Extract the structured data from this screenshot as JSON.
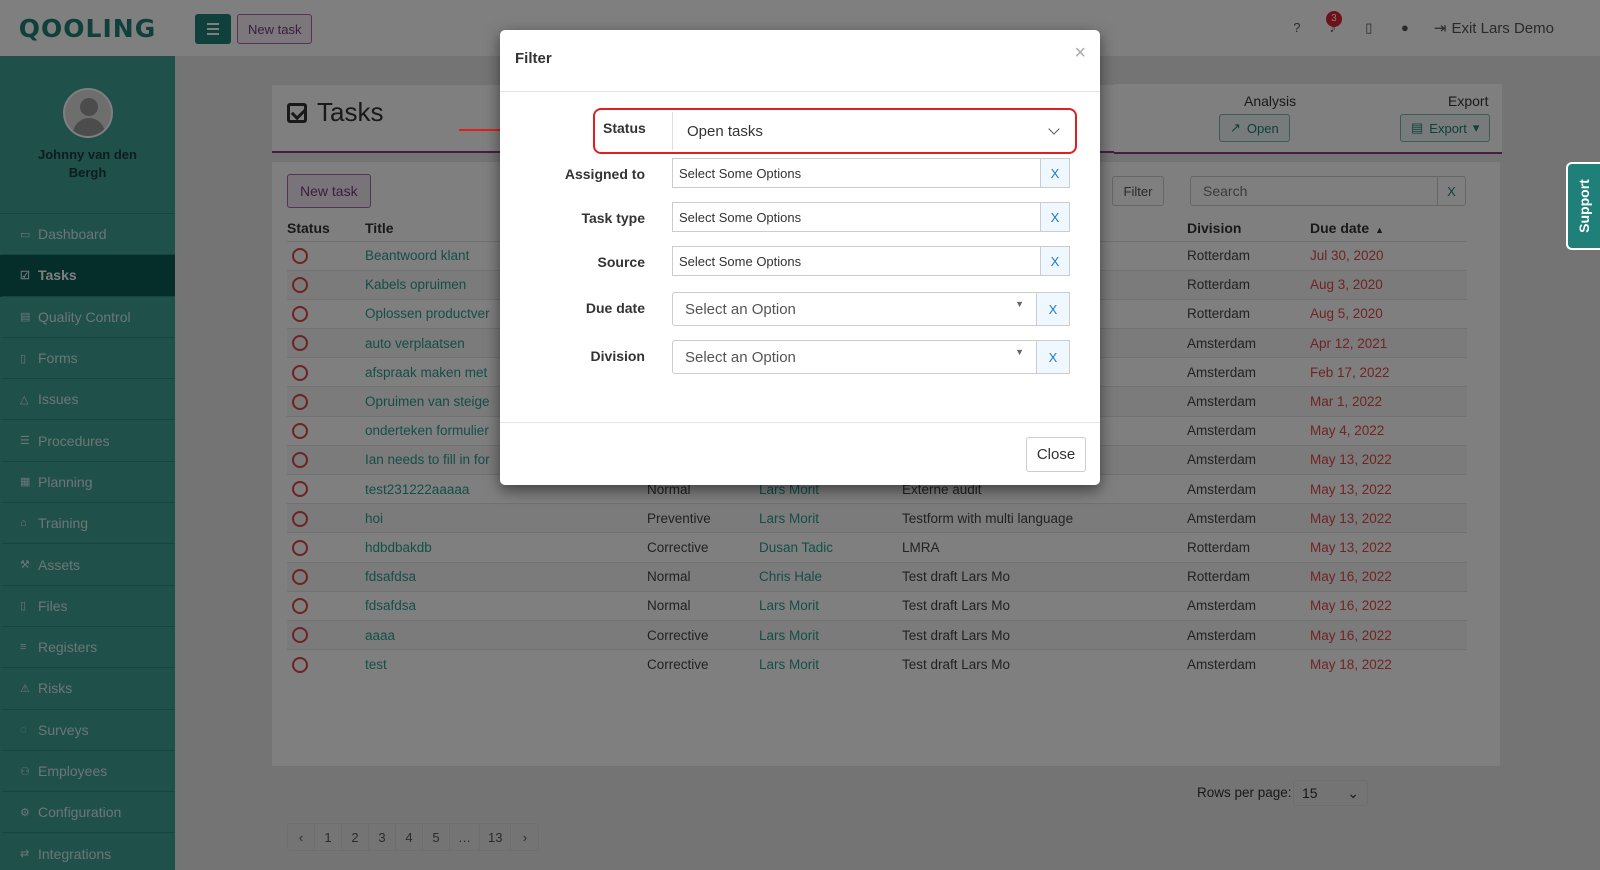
{
  "app": {
    "logo": "QOOLING"
  },
  "topbar": {
    "new_task": "New task",
    "notification_count": "3",
    "exit_demo": "Exit Lars Demo"
  },
  "sidebar": {
    "user_name": "Johnny van den Bergh",
    "items": [
      {
        "label": "Dashboard",
        "icon": "monitor-icon",
        "active": false
      },
      {
        "label": "Tasks",
        "icon": "checkbox-icon",
        "active": true
      },
      {
        "label": "Quality Control",
        "icon": "clipboard-icon",
        "active": false
      },
      {
        "label": "Forms",
        "icon": "form-icon",
        "active": false
      },
      {
        "label": "Issues",
        "icon": "bell-icon",
        "active": false
      },
      {
        "label": "Procedures",
        "icon": "list-icon",
        "active": false
      },
      {
        "label": "Planning",
        "icon": "calendar-icon",
        "active": false
      },
      {
        "label": "Training",
        "icon": "graduation-icon",
        "active": false
      },
      {
        "label": "Assets",
        "icon": "wrench-icon",
        "active": false
      },
      {
        "label": "Files",
        "icon": "file-icon",
        "active": false
      },
      {
        "label": "Registers",
        "icon": "rows-icon",
        "active": false
      },
      {
        "label": "Risks",
        "icon": "warning-icon",
        "active": false
      },
      {
        "label": "Surveys",
        "icon": "chat-icon",
        "active": false
      },
      {
        "label": "Employees",
        "icon": "users-icon",
        "active": false
      },
      {
        "label": "Configuration",
        "icon": "gear-icon",
        "active": false
      },
      {
        "label": "Integrations",
        "icon": "exchange-icon",
        "active": false
      }
    ]
  },
  "page": {
    "title": "Tasks",
    "analysis_label": "Analysis",
    "analysis_button": "Open",
    "export_label": "Export",
    "export_button": "Export",
    "new_task_button": "New task",
    "filter_button": "Filter",
    "search_placeholder": "Search",
    "search_clear": "X"
  },
  "table": {
    "headers": {
      "status": "Status",
      "title": "Title",
      "division": "Division",
      "due_date": "Due date"
    },
    "rows": [
      {
        "title": "Beantwoord klant",
        "type": "",
        "assignee": "",
        "source": "",
        "division": "Rotterdam",
        "due": "Jul 30, 2020"
      },
      {
        "title": "Kabels opruimen",
        "type": "",
        "assignee": "",
        "source": "",
        "division": "Rotterdam",
        "due": "Aug 3, 2020"
      },
      {
        "title": "Oplossen productver",
        "type": "",
        "assignee": "",
        "source": "",
        "division": "Rotterdam",
        "due": "Aug 5, 2020"
      },
      {
        "title": "auto verplaatsen",
        "type": "",
        "assignee": "",
        "source": "",
        "division": "Amsterdam",
        "due": "Apr 12, 2021"
      },
      {
        "title": "afspraak maken met",
        "type": "",
        "assignee": "",
        "source": "",
        "division": "Amsterdam",
        "due": "Feb 17, 2022"
      },
      {
        "title": "Opruimen van steige",
        "type": "",
        "assignee": "",
        "source": "",
        "division": "Amsterdam",
        "due": "Mar 1, 2022"
      },
      {
        "title": "onderteken formulier",
        "type": "",
        "assignee": "",
        "source": "",
        "division": "Amsterdam",
        "due": "May 4, 2022"
      },
      {
        "title": "Ian needs to fill in for",
        "type": "",
        "assignee": "",
        "source": "",
        "division": "Amsterdam",
        "due": "May 13, 2022"
      },
      {
        "title": "test231222aaaaa",
        "type": "Normal",
        "assignee": "Lars Morit",
        "source": "Externe audit",
        "division": "Amsterdam",
        "due": "May 13, 2022"
      },
      {
        "title": "hoi",
        "type": "Preventive",
        "assignee": "Lars Morit",
        "source": "Testform with multi language",
        "division": "Amsterdam",
        "due": "May 13, 2022"
      },
      {
        "title": "hdbdbakdb",
        "type": "Corrective",
        "assignee": "Dusan Tadic",
        "source": "LMRA",
        "division": "Rotterdam",
        "due": "May 13, 2022"
      },
      {
        "title": "fdsafdsa",
        "type": "Normal",
        "assignee": "Chris Hale",
        "source": "Test draft Lars Mo",
        "division": "Rotterdam",
        "due": "May 16, 2022"
      },
      {
        "title": "fdsafdsa",
        "type": "Normal",
        "assignee": "Lars Morit",
        "source": "Test draft Lars Mo",
        "division": "Amsterdam",
        "due": "May 16, 2022"
      },
      {
        "title": "aaaa",
        "type": "Corrective",
        "assignee": "Lars Morit",
        "source": "Test draft Lars Mo",
        "division": "Amsterdam",
        "due": "May 16, 2022"
      },
      {
        "title": "test",
        "type": "Corrective",
        "assignee": "Lars Morit",
        "source": "Test draft Lars Mo",
        "division": "Amsterdam",
        "due": "May 18, 2022"
      }
    ]
  },
  "pagination": {
    "prev": "‹",
    "pages": [
      "1",
      "2",
      "3",
      "4",
      "5",
      "…",
      "13"
    ],
    "next": "›",
    "current": "1"
  },
  "rows_per_page": {
    "label": "Rows per page:",
    "value": "15"
  },
  "support": {
    "label": "Support"
  },
  "modal": {
    "title": "Filter",
    "close_x": "×",
    "status_label": "Status",
    "status_value": "Open tasks",
    "assigned_label": "Assigned to",
    "assigned_placeholder": "Select Some Options",
    "task_type_label": "Task type",
    "task_type_placeholder": "Select Some Options",
    "source_label": "Source",
    "source_placeholder": "Select Some Options",
    "due_date_label": "Due date",
    "due_date_placeholder": "Select an Option",
    "division_label": "Division",
    "division_placeholder": "Select an Option",
    "clear": "X",
    "close_button": "Close"
  }
}
